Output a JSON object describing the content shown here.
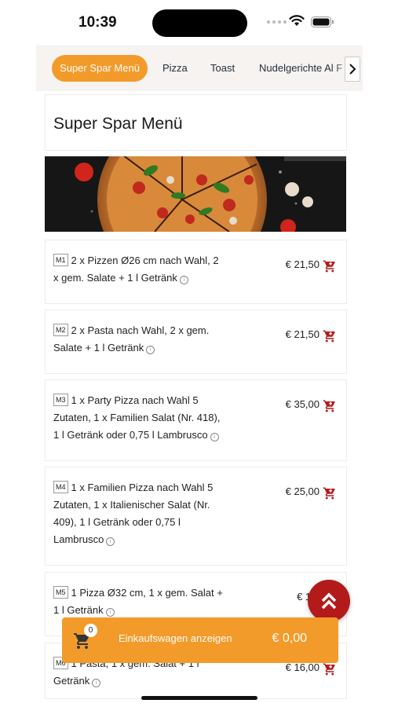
{
  "status_bar": {
    "time": "10:39"
  },
  "categories": [
    {
      "label": "Super Spar Menü",
      "active": true
    },
    {
      "label": "Pizza",
      "active": false
    },
    {
      "label": "Toast",
      "active": false
    },
    {
      "label": "Nudelgerichte Al F",
      "active": false
    }
  ],
  "section": {
    "title": "Super Spar Menü"
  },
  "menu_items": [
    {
      "code": "M1",
      "lines": [
        "2 x Pizzen Ø26 cm nach Wahl, 2",
        "x gem. Salate + 1 l Getränk"
      ],
      "price": "€ 21,50"
    },
    {
      "code": "M2",
      "lines": [
        "2 x Pasta nach Wahl, 2 x gem.",
        "Salate + 1 l Getränk"
      ],
      "price": "€ 21,50"
    },
    {
      "code": "M3",
      "lines": [
        "1 x Party Pizza nach Wahl 5",
        "Zutaten, 1 x Familien Salat (Nr. 418),",
        "1 l Getränk oder 0,75 l Lambrusco"
      ],
      "price": "€ 35,00"
    },
    {
      "code": "M4",
      "lines": [
        "1 x Familien Pizza nach Wahl 5",
        "Zutaten, 1 x Italienischer Salat (Nr.",
        "409), 1 l Getränk oder 0,75 l",
        "Lambrusco"
      ],
      "price": "€ 25,00"
    },
    {
      "code": "M5",
      "lines": [
        "1 Pizza Ø32 cm, 1 x gem. Salat +",
        "1 l Getränk"
      ],
      "price": "€ 16,"
    },
    {
      "code": "M6",
      "lines": [
        "1 Pasta, 1 x gem. Salat + 1 l",
        "Getränk"
      ],
      "price": "€ 16,00"
    }
  ],
  "cart": {
    "count": "0",
    "label": "Einkaufswagen anzeigen",
    "total": "€ 0,00"
  },
  "colors": {
    "accent": "#f39b2a",
    "cart_icon": "#b31b1b",
    "fab": "#b31b1b"
  },
  "icons": {
    "cart": "shopping-cart-icon",
    "info": "info-icon",
    "scroll_top": "double-chevron-up-icon",
    "next": "chevron-right-icon"
  }
}
